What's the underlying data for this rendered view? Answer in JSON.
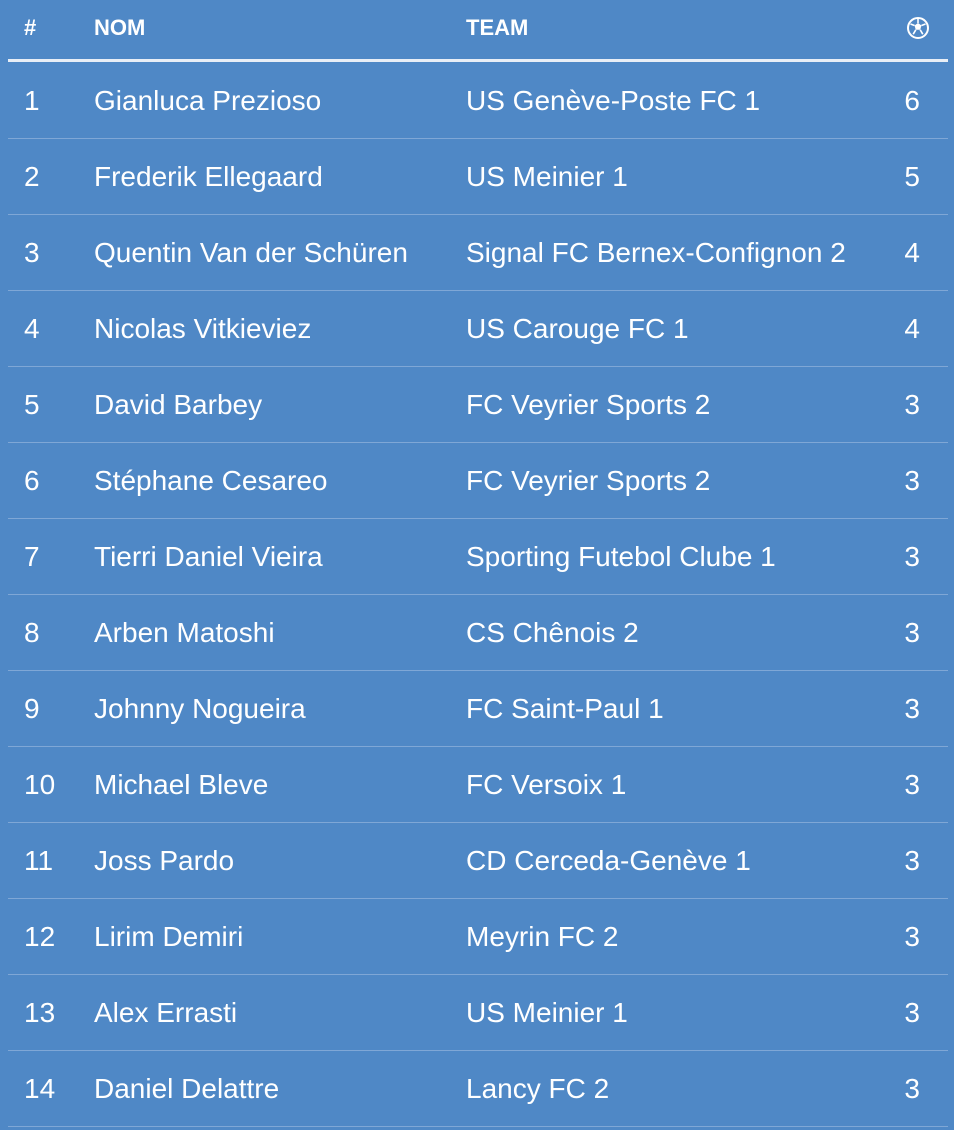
{
  "table": {
    "headers": {
      "rank": "#",
      "name": "NOM",
      "team": "TEAM",
      "goals_icon": "soccer-ball-icon"
    },
    "rows": [
      {
        "rank": "1",
        "name": "Gianluca Prezioso",
        "team": "US Genève-Poste FC 1",
        "goals": "6"
      },
      {
        "rank": "2",
        "name": "Frederik Ellegaard",
        "team": "US Meinier 1",
        "goals": "5"
      },
      {
        "rank": "3",
        "name": "Quentin Van der Schüren",
        "team": "Signal FC Bernex-Confignon 2",
        "goals": "4"
      },
      {
        "rank": "4",
        "name": "Nicolas Vitkieviez",
        "team": "US Carouge FC 1",
        "goals": "4"
      },
      {
        "rank": "5",
        "name": "David Barbey",
        "team": "FC Veyrier Sports 2",
        "goals": "3"
      },
      {
        "rank": "6",
        "name": "Stéphane Cesareo",
        "team": "FC Veyrier Sports 2",
        "goals": "3"
      },
      {
        "rank": "7",
        "name": "Tierri Daniel Vieira",
        "team": "Sporting Futebol Clube 1",
        "goals": "3"
      },
      {
        "rank": "8",
        "name": "Arben Matoshi",
        "team": "CS Chênois 2",
        "goals": "3"
      },
      {
        "rank": "9",
        "name": "Johnny Nogueira",
        "team": "FC Saint-Paul 1",
        "goals": "3"
      },
      {
        "rank": "10",
        "name": "Michael Bleve",
        "team": "FC Versoix 1",
        "goals": "3"
      },
      {
        "rank": "11",
        "name": "Joss Pardo",
        "team": "CD Cerceda-Genève 1",
        "goals": "3"
      },
      {
        "rank": "12",
        "name": "Lirim Demiri",
        "team": "Meyrin FC 2",
        "goals": "3"
      },
      {
        "rank": "13",
        "name": "Alex Errasti",
        "team": "US Meinier 1",
        "goals": "3"
      },
      {
        "rank": "14",
        "name": "Daniel Delattre",
        "team": "Lancy FC 2",
        "goals": "3"
      }
    ]
  },
  "colors": {
    "background": "#4f88c6",
    "text": "#ffffff",
    "divider": "#7fa7d6"
  }
}
